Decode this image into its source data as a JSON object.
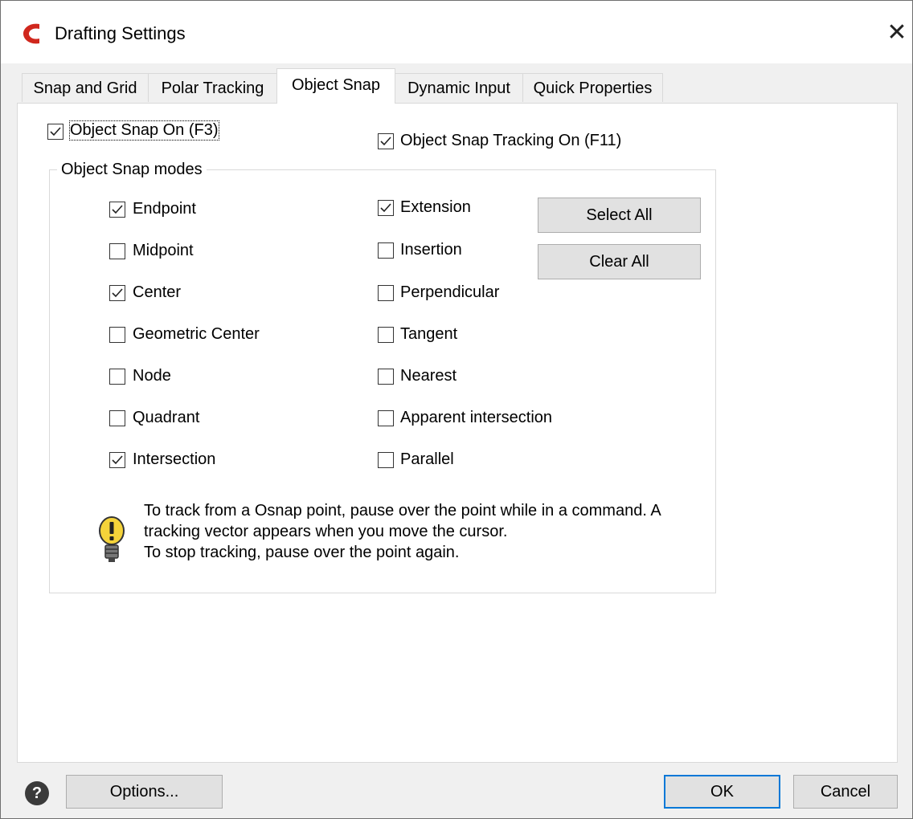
{
  "window": {
    "title": "Drafting Settings",
    "close_glyph": "✕"
  },
  "tabs": [
    {
      "label": "Snap and Grid",
      "active": false
    },
    {
      "label": "Polar Tracking",
      "active": false
    },
    {
      "label": "Object Snap",
      "active": true
    },
    {
      "label": "Dynamic Input",
      "active": false
    },
    {
      "label": "Quick Properties",
      "active": false
    }
  ],
  "object_snap_on": {
    "label": "Object Snap On (F3)",
    "checked": true
  },
  "object_snap_tracking_on": {
    "label": "Object Snap Tracking On (F11)",
    "checked": true
  },
  "modes": {
    "group_title": "Object Snap modes",
    "left": [
      {
        "label": "Endpoint",
        "checked": true
      },
      {
        "label": "Midpoint",
        "checked": false
      },
      {
        "label": "Center",
        "checked": true
      },
      {
        "label": "Geometric Center",
        "checked": false
      },
      {
        "label": "Node",
        "checked": false
      },
      {
        "label": "Quadrant",
        "checked": false
      },
      {
        "label": "Intersection",
        "checked": true
      }
    ],
    "right": [
      {
        "label": "Extension",
        "checked": true
      },
      {
        "label": "Insertion",
        "checked": false
      },
      {
        "label": "Perpendicular",
        "checked": false
      },
      {
        "label": "Tangent",
        "checked": false
      },
      {
        "label": "Nearest",
        "checked": false
      },
      {
        "label": "Apparent intersection",
        "checked": false
      },
      {
        "label": "Parallel",
        "checked": false
      }
    ],
    "select_all_label": "Select All",
    "clear_all_label": "Clear All"
  },
  "hint": {
    "line1": "To track from a Osnap point, pause over the point while in a command. A",
    "line2": "tracking vector appears when you move the cursor.",
    "line3": "To stop tracking, pause over the point again."
  },
  "footer": {
    "help_glyph": "?",
    "options_label": "Options...",
    "ok_label": "OK",
    "cancel_label": "Cancel"
  },
  "colors": {
    "accent": "#0078d7",
    "app_icon": "#c0392b",
    "bulb": "#f5d33a"
  }
}
